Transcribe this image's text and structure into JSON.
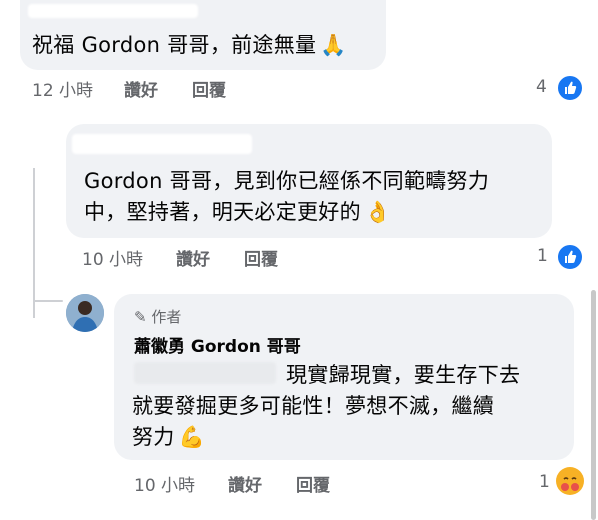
{
  "comments": [
    {
      "text": "祝福 Gordon 哥哥，前途無量",
      "emoji": "🙏",
      "time": "12 小時",
      "like_label": "讚好",
      "reply_label": "回覆",
      "reaction_count": "4",
      "reaction_icon": "thumbs-up-icon"
    },
    {
      "text_line1": "Gordon 哥哥，見到你已經係不同範疇努力",
      "text_line2": "中，堅持著，明天必定更好的",
      "emoji": "👌",
      "time": "10 小時",
      "like_label": "讚好",
      "reply_label": "回覆",
      "reaction_count": "1",
      "reaction_icon": "thumbs-up-icon"
    },
    {
      "author_badge": "作者",
      "author_name": "蕭徽勇 Gordon 哥哥",
      "text_line1": "現實歸現實，要生存下去",
      "text_line2": "就要發掘更多可能性！夢想不滅，繼續",
      "text_line3": "努力",
      "emoji": "💪",
      "time": "10 小時",
      "like_label": "讚好",
      "reply_label": "回覆",
      "reaction_count": "1",
      "reaction_icon": "hug-emoji-icon"
    }
  ],
  "colors": {
    "bubble": "#f0f2f5",
    "meta": "#65676b",
    "like_blue": "#1877f2"
  }
}
